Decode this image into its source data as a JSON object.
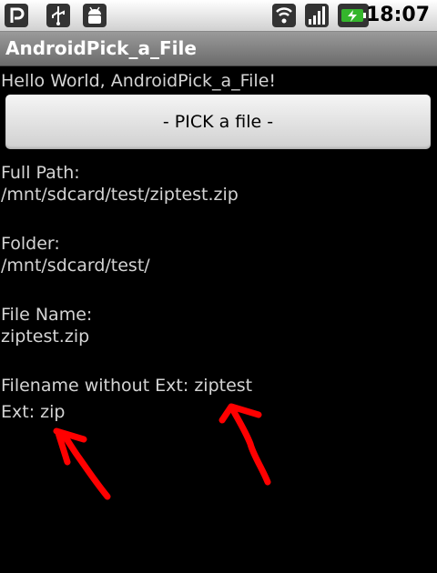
{
  "status_bar": {
    "time": "18:07",
    "icons": [
      "app-p-icon",
      "usb-icon",
      "android-debug-icon",
      "wifi-icon",
      "signal-icon",
      "battery-charging-icon"
    ]
  },
  "app": {
    "title": "AndroidPick_a_File"
  },
  "content": {
    "greeting": "Hello World, AndroidPick_a_File!",
    "pick_button_label": "- PICK a file -",
    "full_path_label": "Full Path:",
    "full_path_value": "/mnt/sdcard/test/ziptest.zip",
    "folder_label": "Folder:",
    "folder_value": "/mnt/sdcard/test/",
    "file_name_label": "File Name:",
    "file_name_value": "ziptest.zip",
    "filename_without_ext": "Filename without Ext: ziptest",
    "ext": "Ext: zip"
  },
  "colors": {
    "annotation": "#ff0000",
    "text": "#d4d4d4",
    "background": "#000000",
    "battery": "#34b62c"
  }
}
